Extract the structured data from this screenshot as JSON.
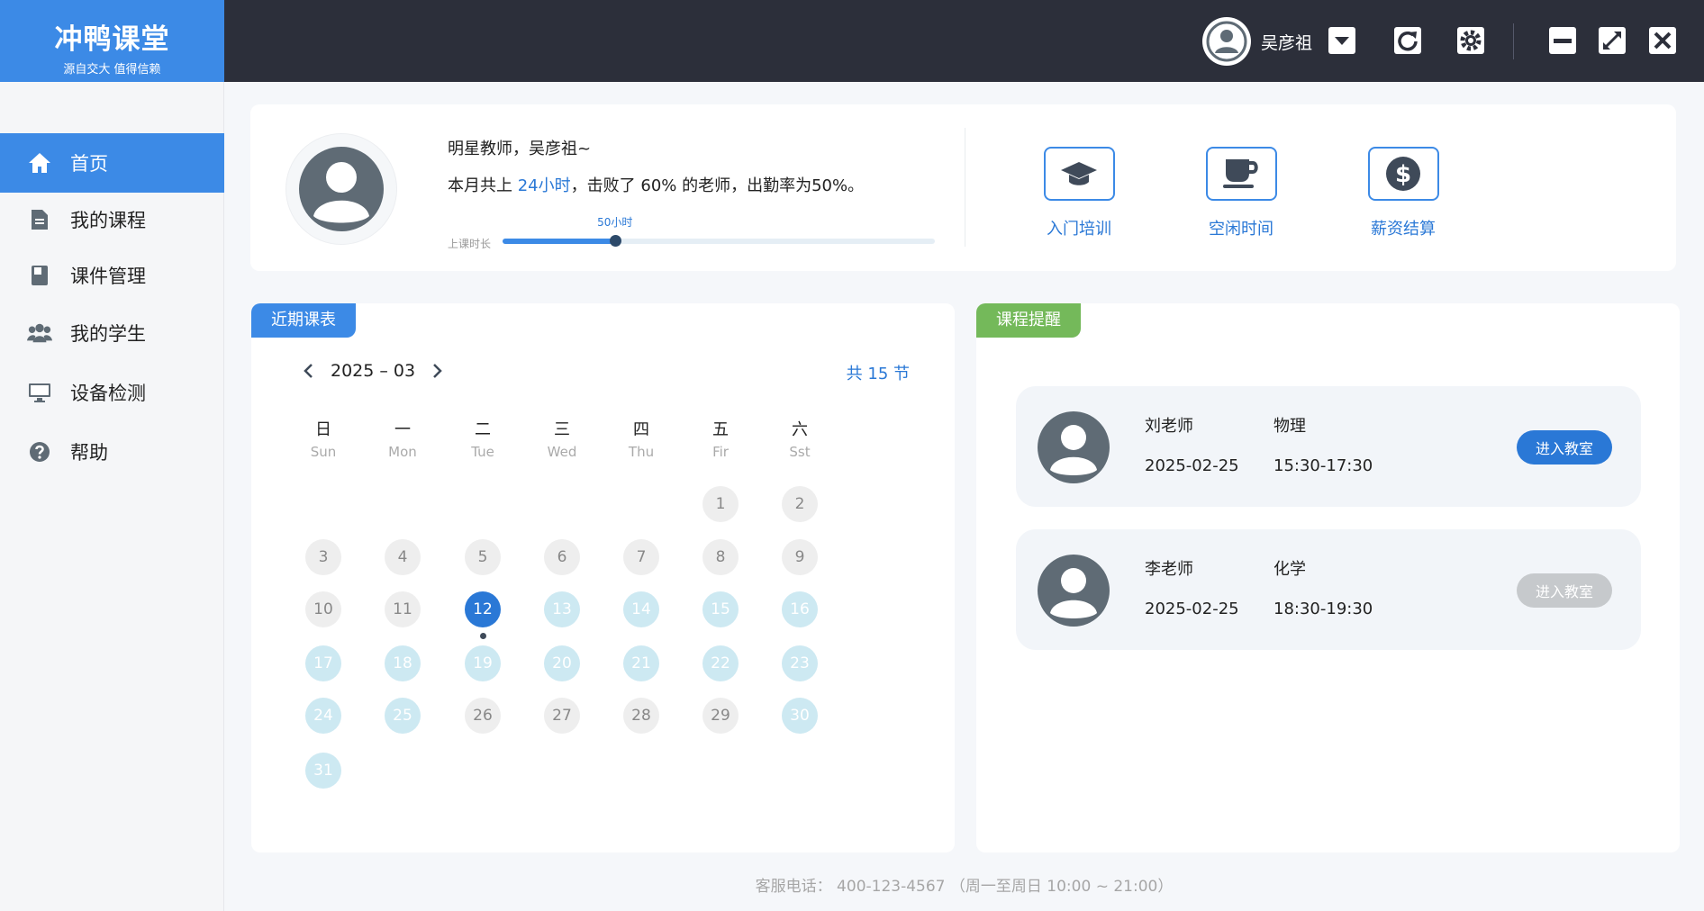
{
  "app": {
    "name": "冲鸭课堂",
    "slogan": "源自交大 值得信赖",
    "brand_color": "#3c8ae6"
  },
  "header": {
    "username": "吴彦祖",
    "icons": [
      "user-avatar-icon",
      "dropdown-icon",
      "refresh-icon",
      "settings-icon",
      "minimize-icon",
      "maximize-icon",
      "close-icon"
    ]
  },
  "sidebar": {
    "items": [
      {
        "label": "首页",
        "icon": "home-icon",
        "active": true
      },
      {
        "label": "我的课程",
        "icon": "document-icon",
        "active": false
      },
      {
        "label": "课件管理",
        "icon": "book-icon",
        "active": false
      },
      {
        "label": "我的学生",
        "icon": "users-icon",
        "active": false
      },
      {
        "label": "设备检测",
        "icon": "monitor-icon",
        "active": false
      },
      {
        "label": "帮助",
        "icon": "help-icon",
        "active": false
      }
    ]
  },
  "profile": {
    "greeting": "明星教师，吴彦祖~",
    "summary_prefix": "本月共上 ",
    "summary_hours": "24小时",
    "summary_suffix": "，击败了 60% 的老师，出勤率为50%。",
    "progress_label": "上课时长",
    "progress_value": "50小时",
    "progress_fraction": 0.26
  },
  "quick_actions": [
    {
      "label": "入门培训",
      "icon": "graduation-cap-icon"
    },
    {
      "label": "空闲时间",
      "icon": "coffee-cup-icon"
    },
    {
      "label": "薪资结算",
      "icon": "dollar-icon"
    }
  ],
  "calendar": {
    "tag": "近期课表",
    "month": "2025 – 03",
    "lesson_count": "共 15 节",
    "weekdays": [
      {
        "cn": "日",
        "en": "Sun"
      },
      {
        "cn": "一",
        "en": "Mon"
      },
      {
        "cn": "二",
        "en": "Tue"
      },
      {
        "cn": "三",
        "en": "Wed"
      },
      {
        "cn": "四",
        "en": "Thu"
      },
      {
        "cn": "五",
        "en": "Fir"
      },
      {
        "cn": "六",
        "en": "Sst"
      }
    ],
    "first_weekday": 5,
    "days_in_month": 31,
    "today": 12,
    "lesson_days": [
      13,
      14,
      15,
      16,
      17,
      18,
      19,
      20,
      21,
      22,
      23,
      24,
      25,
      30,
      31
    ]
  },
  "reminders": {
    "tag": "课程提醒",
    "items": [
      {
        "teacher": "刘老师",
        "subject": "物理",
        "date": "2025-02-25",
        "time": "15:30-17:30",
        "button": "进入教室",
        "enabled": true
      },
      {
        "teacher": "李老师",
        "subject": "化学",
        "date": "2025-02-25",
        "time": "18:30-19:30",
        "button": "进入教室",
        "enabled": false
      }
    ]
  },
  "footer": {
    "text": "客服电话：  400-123-4567  （周一至周日 10:00 ~ 21:00）"
  }
}
